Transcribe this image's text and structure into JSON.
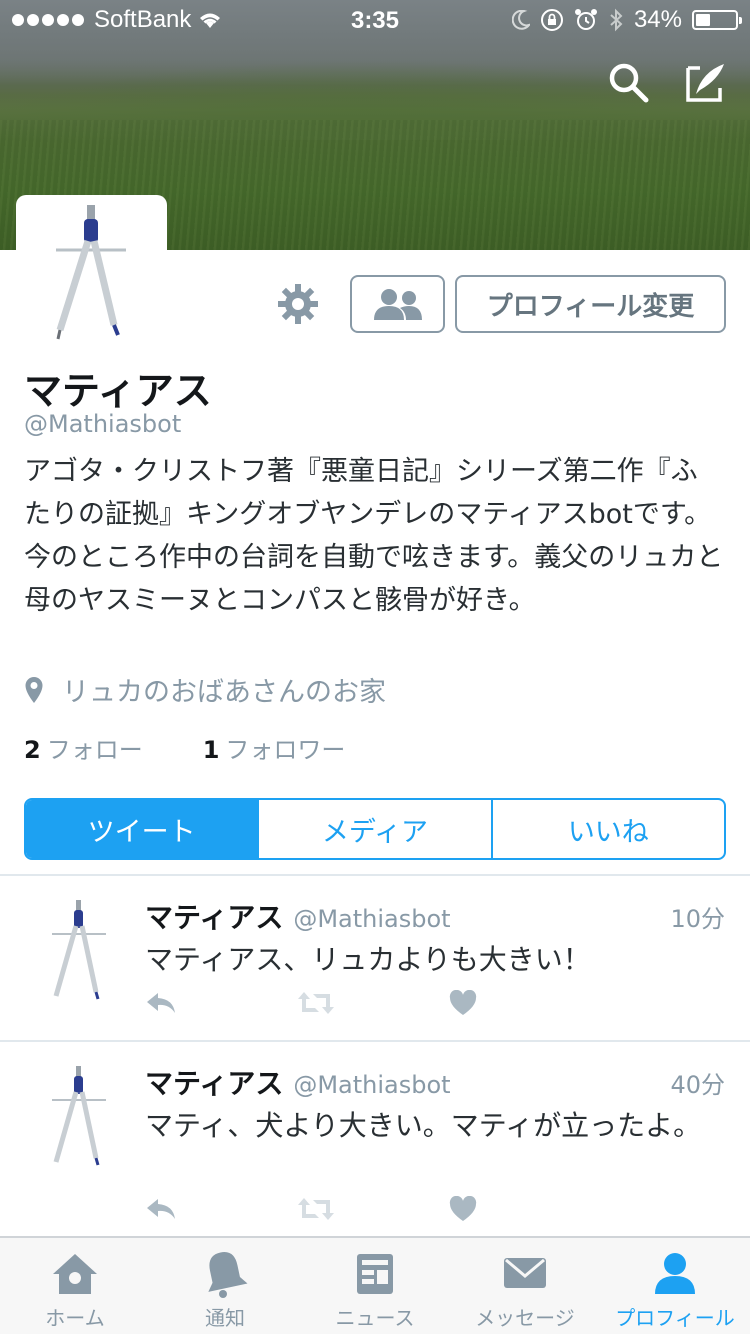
{
  "status_bar": {
    "carrier": "SoftBank",
    "time": "3:35",
    "battery": "34%",
    "battery_level": 0.34
  },
  "profile": {
    "name": "マティアス",
    "handle": "@Mathiasbot",
    "bio": "アゴタ・クリストフ著『悪童日記』シリーズ第二作『ふたりの証拠』キングオブヤンデレのマティアスbotです。 今のところ作中の台詞を自動で呟きます。義父のリュカと母のヤスミーヌとコンパスと骸骨が好き。",
    "location": "リュカのおばあさんのお家",
    "following_count": "2",
    "following_label": "フォロー",
    "followers_count": "1",
    "followers_label": "フォロワー",
    "edit_profile_label": "プロフィール変更"
  },
  "tabs": [
    {
      "label": "ツイート",
      "active": true
    },
    {
      "label": "メディア",
      "active": false
    },
    {
      "label": "いいね",
      "active": false
    }
  ],
  "tweets": [
    {
      "name": "マティアス",
      "handle": "@Mathiasbot",
      "time": "10分",
      "text": "マティアス、リュカよりも大きい！"
    },
    {
      "name": "マティアス",
      "handle": "@Mathiasbot",
      "time": "40分",
      "text": "マティ、犬より大きい。マティが立ったよ。"
    }
  ],
  "tab_bar": [
    {
      "label": "ホーム",
      "icon": "home-icon",
      "active": false
    },
    {
      "label": "通知",
      "icon": "bell-icon",
      "active": false
    },
    {
      "label": "ニュース",
      "icon": "news-icon",
      "active": false
    },
    {
      "label": "メッセージ",
      "icon": "mail-icon",
      "active": false
    },
    {
      "label": "プロフィール",
      "icon": "person-icon",
      "active": true
    }
  ],
  "colors": {
    "accent": "#1da1f2",
    "muted": "#8899a6",
    "text": "#292f33"
  }
}
